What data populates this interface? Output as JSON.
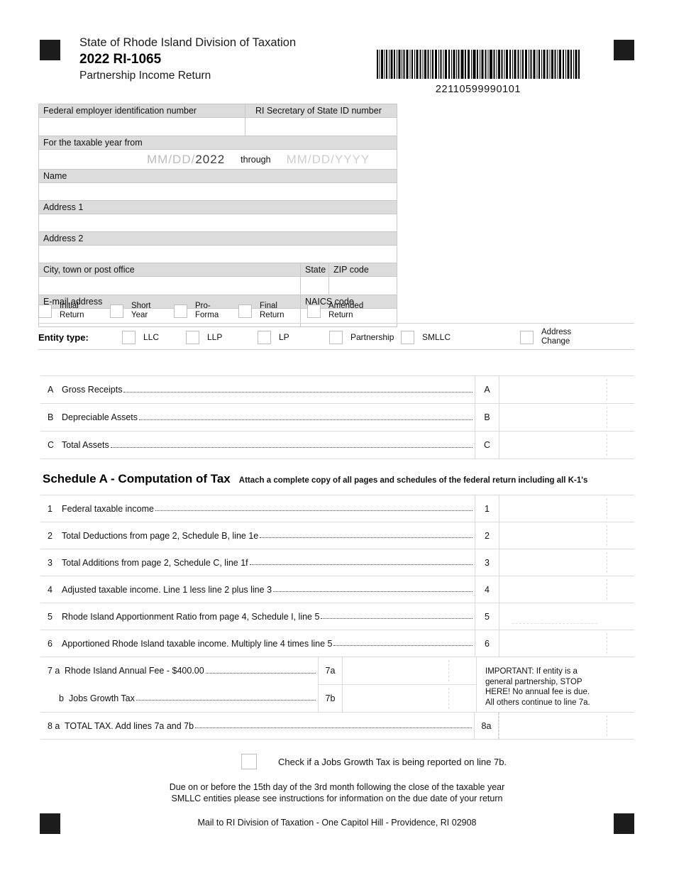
{
  "header": {
    "agency": "State of Rhode Island Division of Taxation",
    "form_title": "2022 RI-1065",
    "form_subtitle": "Partnership Income Return",
    "barcode_number": "22110599990101"
  },
  "taxpayer_info": {
    "fein_label": "Federal employer identification number",
    "fein_value": "",
    "sos_id_label": "RI Secretary of State ID number",
    "sos_id_value": "",
    "taxable_year_label": "For the taxable year from",
    "date_from_placeholder": "MM/DD/",
    "date_from_year": "2022",
    "through_label": "through",
    "date_to_placeholder": "MM/DD/YYYY",
    "name_label": "Name",
    "name_value": "",
    "address1_label": "Address 1",
    "address1_value": "",
    "address2_label": "Address 2",
    "address2_value": "",
    "city_label": "City, town or post office",
    "city_value": "",
    "state_label": "State",
    "state_value": "",
    "zip_label": "ZIP code",
    "zip_value": "",
    "email_label": "E-mail address",
    "email_value": "",
    "naics_label": "NAICS code",
    "naics_value": ""
  },
  "return_type_checkboxes": [
    {
      "label": "Initial\nReturn"
    },
    {
      "label": "Short\nYear"
    },
    {
      "label": "Pro-\nForma"
    },
    {
      "label": "Final\nReturn"
    },
    {
      "label": "Amended\nReturn"
    }
  ],
  "entity_type": {
    "title": "Entity type:",
    "options": [
      {
        "label": "LLC"
      },
      {
        "label": "LLP"
      },
      {
        "label": "LP"
      },
      {
        "label": "Partnership"
      },
      {
        "label": "SMLLC"
      },
      {
        "label": "Address\nChange"
      }
    ]
  },
  "abc_lines": [
    {
      "key": "A",
      "text": "Gross Receipts",
      "value": ""
    },
    {
      "key": "B",
      "text": "Depreciable Assets",
      "value": ""
    },
    {
      "key": "C",
      "text": "Total Assets",
      "value": ""
    }
  ],
  "schedule_a": {
    "title": "Schedule A - Computation of Tax",
    "subtitle": "Attach a complete copy of all pages and schedules of the federal return including all K-1's",
    "lines": [
      {
        "key": "1",
        "text": "Federal taxable income ",
        "value": ""
      },
      {
        "key": "2",
        "text": "Total Deductions from page 2, Schedule B, line 1e",
        "value": ""
      },
      {
        "key": "3",
        "text": "Total Additions from page 2, Schedule C, line 1f",
        "value": ""
      },
      {
        "key": "4",
        "text": "Adjusted taxable income.  Line 1 less line 2 plus line 3",
        "value": ""
      },
      {
        "key": "5",
        "text": "Rhode Island Apportionment Ratio from page 4, Schedule I, line 5 ",
        "value": ""
      },
      {
        "key": "6",
        "text": "Apportioned Rhode Island taxable income.  Multiply line 4 times line 5 ",
        "value": ""
      }
    ],
    "line7a": {
      "num": "7 a",
      "key": "7a",
      "text": "Rhode Island Annual Fee - $400.00",
      "value": ""
    },
    "line7b": {
      "num": "b",
      "key": "7b",
      "text": "Jobs Growth Tax",
      "value": ""
    },
    "important_note": "IMPORTANT: If entity is a\ngeneral partnership, STOP\nHERE! No annual fee is due.\nAll others continue to line 7a.",
    "line8a": {
      "num": "8 a",
      "key": "8a",
      "text": "TOTAL TAX. Add lines 7a and 7b",
      "value": ""
    }
  },
  "footer": {
    "jobs_growth_checkbox_label": "Check if a Jobs Growth Tax is being reported on line 7b.",
    "due_text": "Due on or before the 15th day of the 3rd month following the close of the taxable year\nSMLLC entities please see instructions for information on the due date of your return",
    "mail_text": "Mail to RI Division of Taxation - One Capitol Hill - Providence, RI 02908"
  }
}
